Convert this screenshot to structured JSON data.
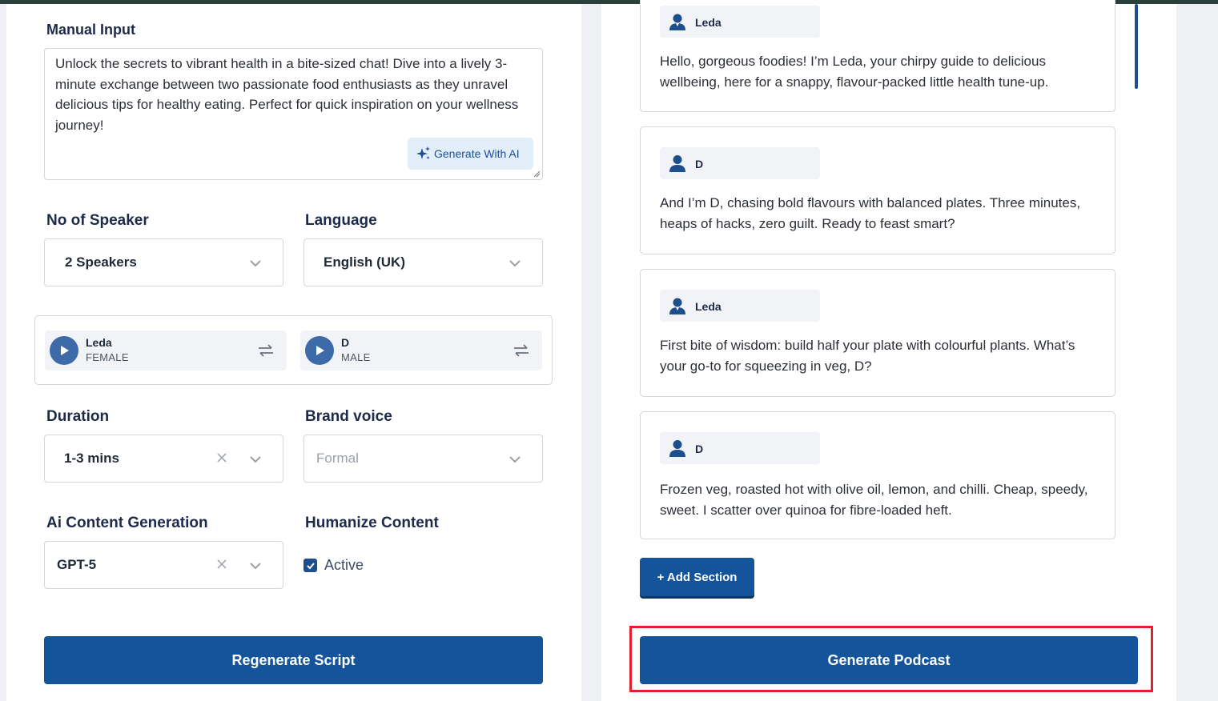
{
  "colors": {
    "primary": "#14549a",
    "highlight": "#e3202b",
    "ai_button_bg": "#e3eefb",
    "top_bar": "#29403a"
  },
  "manual_input": {
    "label": "Manual Input",
    "text": "Unlock the secrets to vibrant health in a bite-sized chat! Dive into a lively 3-minute exchange between two passionate food enthusiasts as they unravel delicious tips for healthy eating. Perfect for quick inspiration on your wellness journey!",
    "generate_ai_label": "Generate With AI",
    "generate_ai_icon": "sparkles-icon"
  },
  "speakers": {
    "label": "No of Speaker",
    "value": "2 Speakers"
  },
  "language": {
    "label": "Language",
    "value": "English (UK)"
  },
  "voices": [
    {
      "name": "Leda",
      "gender": "FEMALE",
      "icon": "play-icon",
      "swap_icon": "swap-icon"
    },
    {
      "name": "D",
      "gender": "MALE",
      "icon": "play-icon",
      "swap_icon": "swap-icon"
    }
  ],
  "duration": {
    "label": "Duration",
    "value": "1-3 mins"
  },
  "brand_voice": {
    "label": "Brand voice",
    "placeholder": "Formal"
  },
  "ai_generation": {
    "label": "Ai Content Generation",
    "value": "GPT-5"
  },
  "humanize": {
    "label": "Humanize Content",
    "checked": true,
    "option_label": "Active"
  },
  "regenerate_label": "Regenerate Script",
  "script_sections": [
    {
      "speaker": "Leda",
      "speaker_icon": "female-user-icon",
      "text": "Hello, gorgeous foodies! I’m Leda, your chirpy guide to delicious wellbeing, here for a snappy, flavour-packed little health tune-up."
    },
    {
      "speaker": "D",
      "speaker_icon": "male-user-icon",
      "text": "And I’m D, chasing bold flavours with balanced plates. Three minutes, heaps of hacks, zero guilt. Ready to feast smart?"
    },
    {
      "speaker": "Leda",
      "speaker_icon": "female-user-icon",
      "text": "First bite of wisdom: build half your plate with colourful plants. What’s your go-to for squeezing in veg, D?"
    },
    {
      "speaker": "D",
      "speaker_icon": "male-user-icon",
      "text": "Frozen veg, roasted hot with olive oil, lemon, and chilli. Cheap, speedy, sweet. I scatter over quinoa for fibre-loaded heft."
    }
  ],
  "add_section_label": "+ Add Section",
  "generate_podcast_label": "Generate Podcast"
}
